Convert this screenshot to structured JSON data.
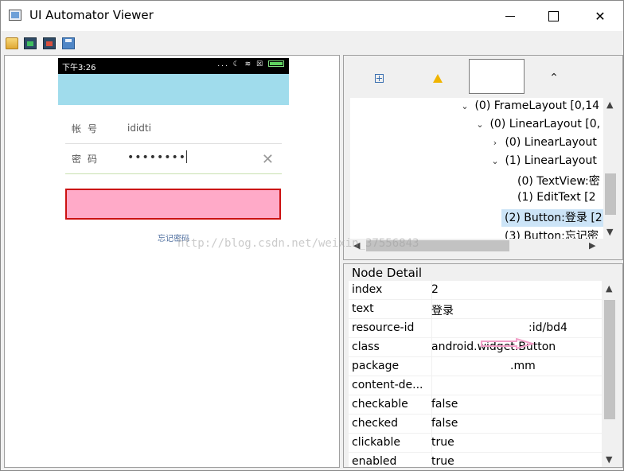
{
  "window": {
    "title": "UI Automator Viewer"
  },
  "device": {
    "status_time": "下午3:26",
    "status_icons": "... ☾ ≋ ☒",
    "account_label": "帐号",
    "account_value": "ididti",
    "password_label": "密码",
    "password_value": "••••••••",
    "clear_glyph": "✕",
    "forgot_link": "忘记密码"
  },
  "hierarchy": {
    "rows": [
      {
        "twisty": "⌄",
        "label": "(0) FrameLayout [0,14"
      },
      {
        "twisty": "⌄",
        "label": "(0) LinearLayout [0,"
      },
      {
        "twisty": "›",
        "label": "(0) LinearLayout"
      },
      {
        "twisty": "⌄",
        "label": "(1) LinearLayout"
      },
      {
        "twisty": "",
        "label": "(0) TextView:密"
      },
      {
        "twisty": "",
        "label": "(1) EditText [2"
      },
      {
        "twisty": "",
        "label": "(2) Button:登录 [2"
      },
      {
        "twisty": "",
        "label": "(3) Button:忘记密"
      }
    ]
  },
  "node_detail": {
    "title": "Node Detail",
    "rows": [
      {
        "key": "index",
        "value": "2"
      },
      {
        "key": "text",
        "value": "登录"
      },
      {
        "key": "resource-id",
        "value": ":id/bd4"
      },
      {
        "key": "class",
        "value": "android.widget.Button"
      },
      {
        "key": "package",
        "value": ".mm"
      },
      {
        "key": "content-de...",
        "value": ""
      },
      {
        "key": "checkable",
        "value": "false"
      },
      {
        "key": "checked",
        "value": "false"
      },
      {
        "key": "clickable",
        "value": "true"
      },
      {
        "key": "enabled",
        "value": "true"
      }
    ]
  },
  "watermark": "http://blog.csdn.net/weixin_37556843",
  "colors": {
    "login_fill": "#ffaac8",
    "login_border": "#cc1111",
    "appbar": "#a0dcec",
    "selected_row": "#cce4f7"
  }
}
